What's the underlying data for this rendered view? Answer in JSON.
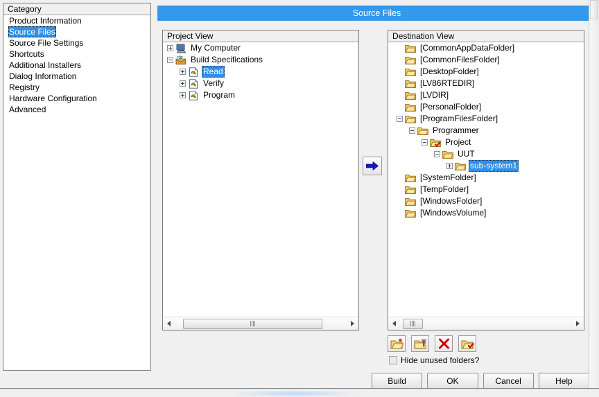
{
  "window": {
    "title": "Source Files"
  },
  "category": {
    "header": "Category",
    "items": [
      {
        "label": "Product Information",
        "selected": false
      },
      {
        "label": "Source Files",
        "selected": true
      },
      {
        "label": "Source File Settings",
        "selected": false
      },
      {
        "label": "Shortcuts",
        "selected": false
      },
      {
        "label": "Additional Installers",
        "selected": false
      },
      {
        "label": "Dialog Information",
        "selected": false
      },
      {
        "label": "Registry",
        "selected": false
      },
      {
        "label": "Hardware Configuration",
        "selected": false
      },
      {
        "label": "Advanced",
        "selected": false
      }
    ]
  },
  "project_view": {
    "header": "Project View",
    "nodes": [
      {
        "label": "My Computer",
        "depth": 0,
        "expander": "plus",
        "icon": "computer-icon",
        "selected": false
      },
      {
        "label": "Build Specifications",
        "depth": 0,
        "expander": "minus",
        "icon": "build-spec-icon",
        "selected": false
      },
      {
        "label": "Read",
        "depth": 1,
        "expander": "plus",
        "icon": "vi-document-icon",
        "selected": true
      },
      {
        "label": "Verify",
        "depth": 1,
        "expander": "plus",
        "icon": "vi-document-icon",
        "selected": false
      },
      {
        "label": "Program",
        "depth": 1,
        "expander": "plus",
        "icon": "vi-document-icon",
        "selected": false
      }
    ]
  },
  "destination_view": {
    "header": "Destination View",
    "nodes": [
      {
        "label": "[CommonAppDataFolder]",
        "depth": 0,
        "expander": "none",
        "icon": "folder-icon",
        "selected": false
      },
      {
        "label": "[CommonFilesFolder]",
        "depth": 0,
        "expander": "none",
        "icon": "folder-icon",
        "selected": false
      },
      {
        "label": "[DesktopFolder]",
        "depth": 0,
        "expander": "none",
        "icon": "folder-icon",
        "selected": false
      },
      {
        "label": "[LV86RTEDIR]",
        "depth": 0,
        "expander": "none",
        "icon": "folder-icon",
        "selected": false
      },
      {
        "label": "[LVDIR]",
        "depth": 0,
        "expander": "none",
        "icon": "folder-icon",
        "selected": false
      },
      {
        "label": "[PersonalFolder]",
        "depth": 0,
        "expander": "none",
        "icon": "folder-icon",
        "selected": false
      },
      {
        "label": "[ProgramFilesFolder]",
        "depth": 0,
        "expander": "minus",
        "icon": "folder-icon",
        "selected": false
      },
      {
        "label": "Programmer",
        "depth": 1,
        "expander": "minus",
        "icon": "folder-icon",
        "selected": false
      },
      {
        "label": "Project",
        "depth": 2,
        "expander": "minus",
        "icon": "folder-checked-icon",
        "selected": false
      },
      {
        "label": "UUT",
        "depth": 3,
        "expander": "minus",
        "icon": "folder-icon",
        "selected": false
      },
      {
        "label": "sub-system1",
        "depth": 4,
        "expander": "plus",
        "icon": "folder-icon",
        "selected": true
      },
      {
        "label": "[SystemFolder]",
        "depth": 0,
        "expander": "none",
        "icon": "folder-icon",
        "selected": false
      },
      {
        "label": "[TempFolder]",
        "depth": 0,
        "expander": "none",
        "icon": "folder-icon",
        "selected": false
      },
      {
        "label": "[WindowsFolder]",
        "depth": 0,
        "expander": "none",
        "icon": "folder-icon",
        "selected": false
      },
      {
        "label": "[WindowsVolume]",
        "depth": 0,
        "expander": "none",
        "icon": "folder-icon",
        "selected": false
      }
    ]
  },
  "transfer": {
    "icon": "arrow-right-icon"
  },
  "actions": [
    {
      "name": "add-folder-button",
      "icon": "open-folder-icon"
    },
    {
      "name": "new-folder-button",
      "icon": "folder-build-icon"
    },
    {
      "name": "delete-button",
      "icon": "red-x-icon"
    },
    {
      "name": "set-folder-button",
      "icon": "folder-checked-icon"
    }
  ],
  "hide_unused": {
    "label": "Hide unused folders?",
    "checked": false
  },
  "dialog_buttons": [
    {
      "label": "Build"
    },
    {
      "label": "OK"
    },
    {
      "label": "Cancel"
    },
    {
      "label": "Help"
    }
  ],
  "colors": {
    "title_bar": "#3498ec",
    "selection": "#2f8fe8",
    "panel_bg": "#f0f0f0",
    "list_bg": "#ffffff",
    "border": "#7b7b7b"
  }
}
